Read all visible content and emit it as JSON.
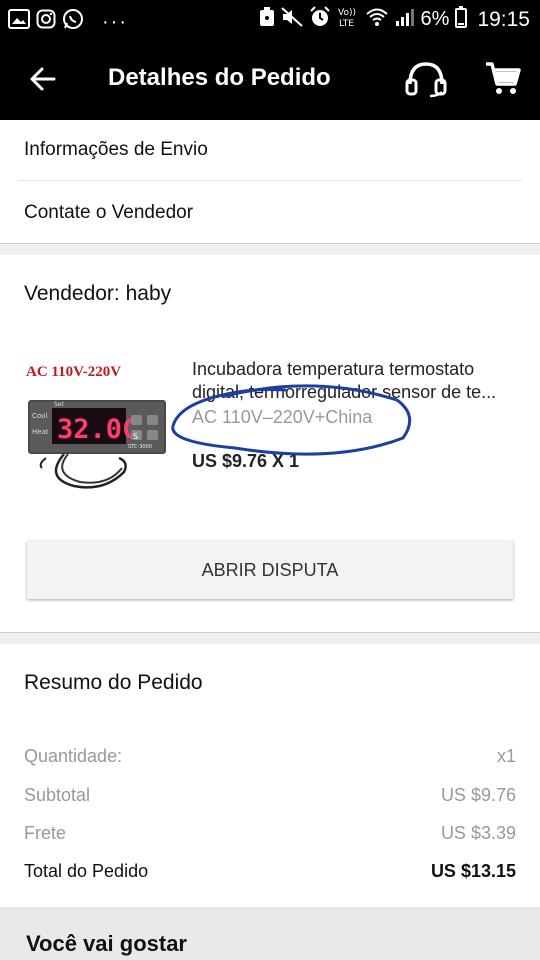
{
  "status_bar": {
    "battery_pct": "6%",
    "time": "19:15",
    "dots": "···",
    "volte": "Vo)) LTE"
  },
  "header": {
    "title": "Detalhes do Pedido",
    "icons": [
      "back-arrow-icon",
      "headset-icon",
      "cart-icon"
    ]
  },
  "menu": {
    "shipping_info": "Informações de Envio",
    "contact_seller": "Contate o Vendedor"
  },
  "seller": {
    "label": "Vendedor: haby"
  },
  "product": {
    "title_line1": "Incubadora temperatura termostato",
    "title_line2": "digital, termorregulador sensor de te...",
    "variant": "AC 110V–220V+China",
    "price": "US $9.76  X 1",
    "image": {
      "banner_text": "AC 110V-220V",
      "display_text": "32.0C",
      "model_text": "STC-3000",
      "side_labels": [
        "Cool",
        "Heat"
      ],
      "set_label": "Set",
      "button_s": "S"
    },
    "annotation_color": "#1f3fa0"
  },
  "actions": {
    "dispute_label": "ABRIR DISPUTA"
  },
  "summary": {
    "title": "Resumo do Pedido",
    "rows": [
      {
        "label": "Quantidade:",
        "value": "x1"
      },
      {
        "label": "Subtotal",
        "value": "US $9.76"
      },
      {
        "label": "Frete",
        "value": "US $3.39"
      }
    ],
    "total": {
      "label": "Total do Pedido",
      "value": "US $13.15"
    }
  },
  "recommend": {
    "title": "Você vai gostar"
  }
}
